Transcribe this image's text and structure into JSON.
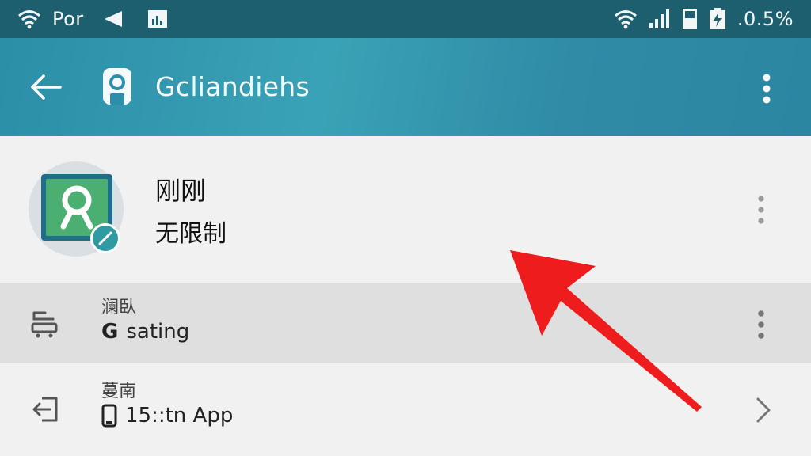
{
  "status_bar": {
    "carrier": "Por",
    "battery_text": ".0.5%"
  },
  "app_bar": {
    "title": "Gcliandiehs"
  },
  "profile": {
    "name": "刚刚",
    "subtitle": "无限制"
  },
  "rows": [
    {
      "title": "澜臥",
      "lead": "G",
      "value": "sating"
    },
    {
      "title": "蔓南",
      "value": "15::tn App"
    }
  ],
  "colors": {
    "status_bar": "#1e5f6f",
    "app_bar": "#2c8ea8",
    "avatar_green": "#4caf72",
    "badge_teal": "#2f9aa2",
    "arrow_red": "#ee1c1c"
  },
  "icons": {
    "wifi": "wifi-icon",
    "nav_back": "back-arrow-icon",
    "image": "image-icon",
    "signal": "signal-icon",
    "sim": "sim-icon",
    "battery": "battery-charging-icon",
    "app_logo": "location-pin-icon",
    "overflow": "more-vert-icon",
    "avatar": "person-search-icon",
    "row1": "sort-icon",
    "row2": "exit-icon",
    "phone": "phone-icon",
    "chevron": "chevron-right-icon"
  }
}
